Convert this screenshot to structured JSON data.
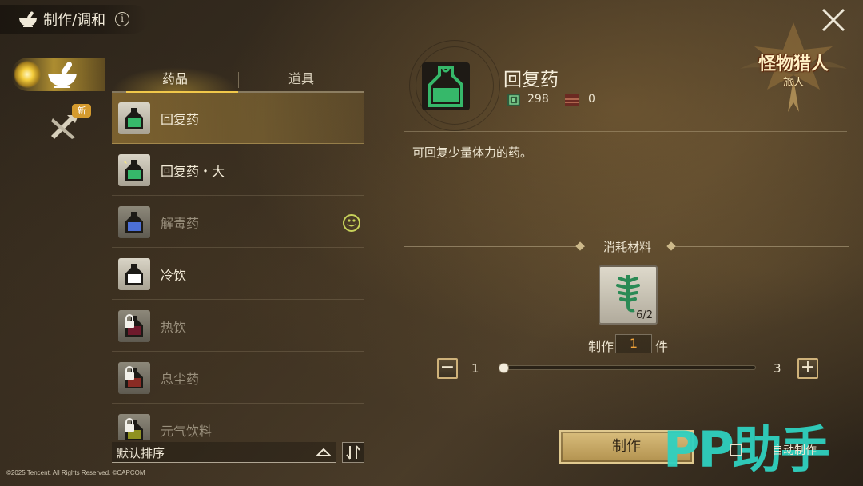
{
  "header": {
    "title": "制作/调和",
    "info_icon": "i"
  },
  "rail": {
    "items": [
      {
        "icon": "mortar-bowl-icon",
        "active": true
      },
      {
        "icon": "crafting-tools-icon",
        "badge": "新"
      }
    ]
  },
  "tabs": [
    {
      "label": "药品",
      "active": true
    },
    {
      "label": "道具",
      "active": false
    }
  ],
  "items": [
    {
      "label": "回复药",
      "color": "#36b86a",
      "selected": true,
      "locked": false
    },
    {
      "label": "回复药・大",
      "color": "#36b86a",
      "selected": false,
      "locked": false
    },
    {
      "label": "解毒药",
      "color": "#4c6fd6",
      "selected": false,
      "locked": false,
      "dim": true,
      "badge_icon": "monster-face-icon"
    },
    {
      "label": "冷饮",
      "color": "#ffffff",
      "selected": false,
      "locked": false
    },
    {
      "label": "热饮",
      "color": "#b6284a",
      "selected": false,
      "locked": true,
      "dim": true
    },
    {
      "label": "息尘药",
      "color": "#d2433c",
      "selected": false,
      "locked": true,
      "dim": true
    },
    {
      "label": "元气饮料",
      "color": "#c9cc2c",
      "selected": false,
      "locked": true,
      "dim": true
    }
  ],
  "sort": {
    "label": "默认排序"
  },
  "copyright": "©2025 Tencent. All Rights Reserved. ©CAPCOM",
  "detail": {
    "name": "回复药",
    "owned": "298",
    "stored": "0",
    "description": "可回复少量体力的药。"
  },
  "materials": {
    "title": "消耗材料",
    "items": [
      {
        "icon": "herb-icon",
        "count": "6/2"
      }
    ]
  },
  "craft": {
    "prefix": "制作",
    "quantity": "1",
    "suffix": "件",
    "min": "1",
    "max": "3",
    "button": "制作",
    "auto_label": "自动制作"
  },
  "logo": {
    "title": "怪物猎人",
    "subtitle": "旅人"
  },
  "watermark": "PP助手",
  "colors": {
    "accent": "#f1c84a",
    "qty": "#f0a33a",
    "potion_green": "#36b86a"
  }
}
